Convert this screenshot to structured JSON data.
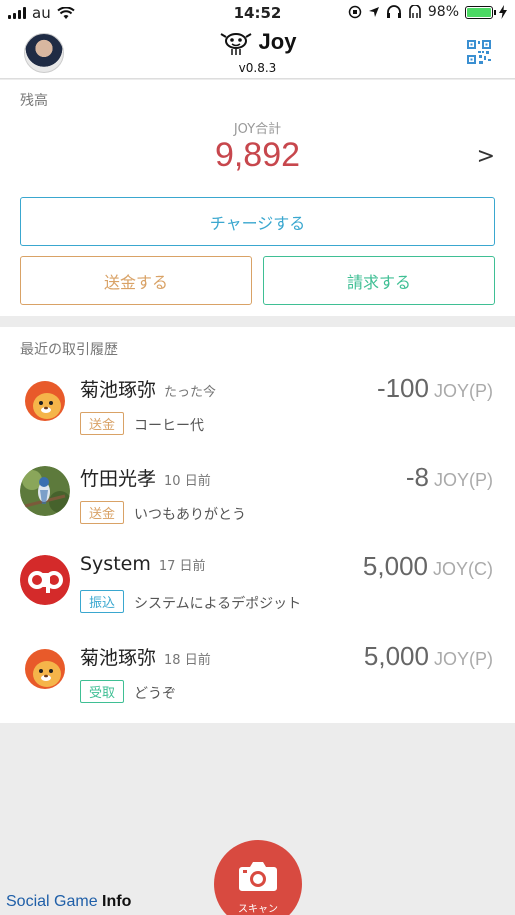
{
  "status_bar": {
    "carrier": "au",
    "time": "14:52",
    "battery": "98%",
    "battery_level": 0.98
  },
  "header": {
    "title": "Joy",
    "version": "v0.8.3",
    "left_icon": "user-avatar",
    "right_icon": "qr-code-icon"
  },
  "balance": {
    "section_label": "残高",
    "total_label": "JOY合計",
    "amount": "9,892",
    "chevron": ">",
    "charge_label": "チャージする",
    "send_label": "送金する",
    "request_label": "請求する"
  },
  "history": {
    "section_label": "最近の取引履歴",
    "rows": [
      {
        "name": "菊池琢弥",
        "time": "たった今",
        "badge": "送金",
        "memo": "コーヒー代",
        "value": "-100",
        "unit": "JOY(P)"
      },
      {
        "name": "竹田光孝",
        "time": "10 日前",
        "badge": "送金",
        "memo": "いつもありがとう",
        "value": "-8",
        "unit": "JOY(P)"
      },
      {
        "name": "System",
        "time": "17 日前",
        "badge": "振込",
        "memo": "システムによるデポジット",
        "value": "5,000",
        "unit": "JOY(C)"
      },
      {
        "name": "菊池琢弥",
        "time": "18 日前",
        "badge": "受取",
        "memo": "どうぞ",
        "value": "5,000",
        "unit": "JOY(P)"
      }
    ]
  },
  "footer": {
    "watermark_a": "Social Game ",
    "watermark_b": "Info",
    "scan_label": "スキャン"
  },
  "colors": {
    "balance": "#c7474d",
    "charge": "#3aa7cf",
    "send": "#d9a266",
    "request": "#3fbf94",
    "scan": "#d84a40"
  }
}
